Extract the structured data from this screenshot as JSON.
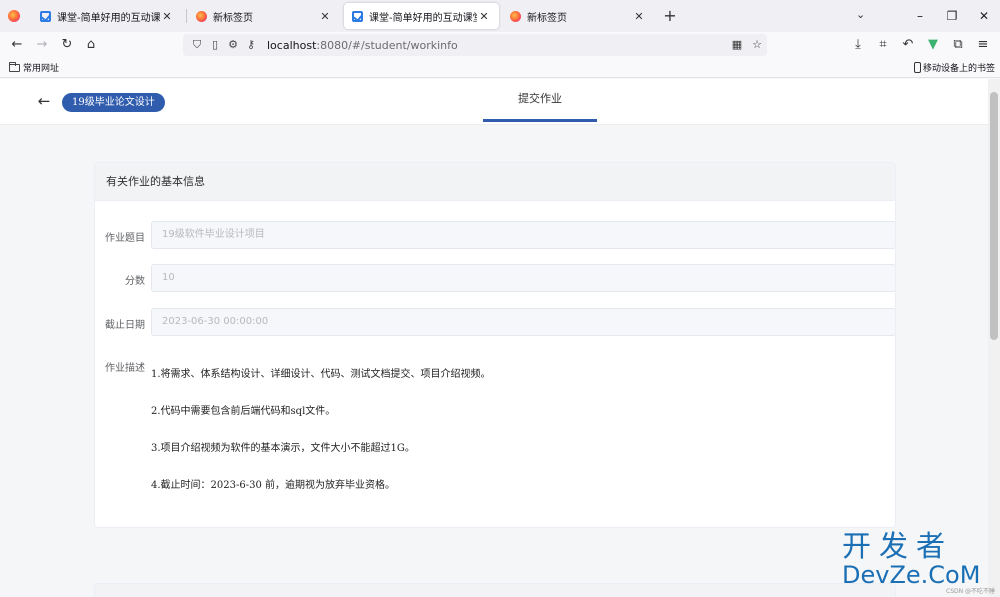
{
  "browser": {
    "tabs": [
      {
        "title": "课堂-简单好用的互动课堂管理工",
        "active": false,
        "favicon": "app-check-icon"
      },
      {
        "title": "新标签页",
        "active": false,
        "favicon": "firefox-icon"
      },
      {
        "title": "课堂-简单好用的互动课堂管理工",
        "active": true,
        "favicon": "app-check-icon"
      },
      {
        "title": "新标签页",
        "active": false,
        "favicon": "firefox-icon"
      }
    ],
    "url": {
      "host": "localhost",
      "rest": ":8080/#/student/workinfo"
    },
    "bookmarks": {
      "left": "常用网址",
      "right": "移动设备上的书签"
    }
  },
  "page": {
    "course_name": "19级毕业论文设计",
    "active_tab": "提交作业",
    "card_title": "有关作业的基本信息",
    "fields": {
      "title_label": "作业题目",
      "title_value": "19级软件毕业设计项目",
      "score_label": "分数",
      "score_value": "10",
      "deadline_label": "截止日期",
      "deadline_value": "2023-06-30 00:00:00",
      "desc_label": "作业描述"
    },
    "description": [
      "1.将需求、体系结构设计、详细设计、代码、测试文档提交、项目介绍视频。",
      "2.代码中需要包含前后端代码和sql文件。",
      "3.项目介绍视频为软件的基本演示，文件大小不能超过1G。",
      "4.截止时间：2023-6-30 前，逾期视为放弃毕业资格。"
    ]
  },
  "watermark": {
    "cn": "开发者",
    "en": "DevZe.CoM",
    "small": "CSDN @不吃不睡"
  },
  "colors": {
    "accent": "#2f5cad",
    "watermark": "#1a6fb5"
  }
}
